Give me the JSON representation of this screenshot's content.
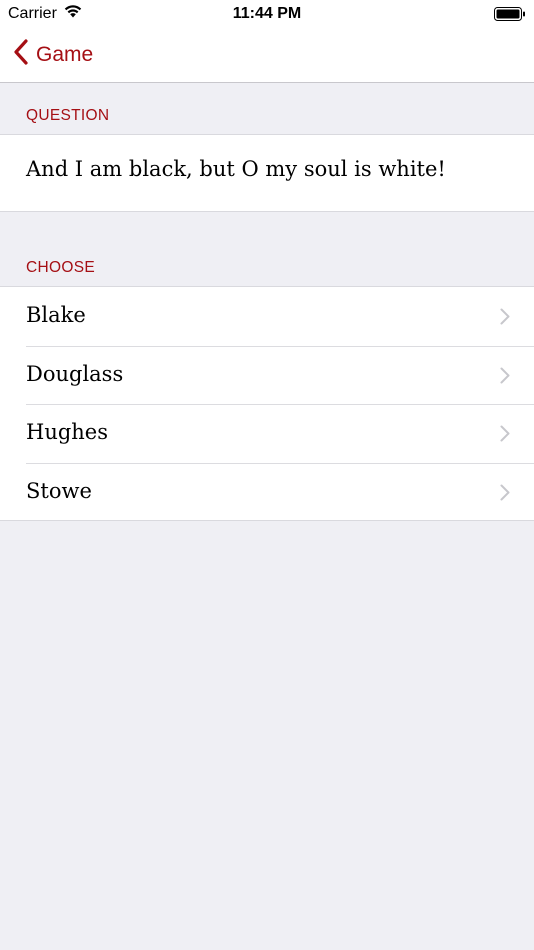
{
  "status_bar": {
    "carrier": "Carrier",
    "time": "11:44 PM"
  },
  "nav": {
    "back_label": "Game"
  },
  "question_section": {
    "header": "QUESTION",
    "text": "And I am black, but O my soul is white!"
  },
  "choose_section": {
    "header": "CHOOSE",
    "options": [
      "Blake",
      "Douglass",
      "Hughes",
      "Stowe"
    ]
  },
  "colors": {
    "accent": "#a50f14",
    "background": "#efeff4"
  },
  "icons": {
    "wifi": "wifi-icon",
    "battery": "battery-icon",
    "back": "chevron-left-icon",
    "disclosure": "chevron-right-icon"
  }
}
